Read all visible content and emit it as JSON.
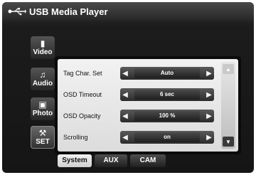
{
  "header": {
    "title": "USB Media Player"
  },
  "sidebar": {
    "items": [
      {
        "label": "Video",
        "icon": "film-icon"
      },
      {
        "label": "Audio",
        "icon": "music-note-icon"
      },
      {
        "label": "Photo",
        "icon": "camera-icon"
      },
      {
        "label": "SET",
        "icon": "wrench-icon"
      }
    ]
  },
  "settings": {
    "rows": [
      {
        "label": "Tag Char. Set",
        "value": "Auto"
      },
      {
        "label": "OSD Timeout",
        "value": "6 sec"
      },
      {
        "label": "OSD Opacity",
        "value": "100 %"
      },
      {
        "label": "Scrolling",
        "value": "on"
      }
    ]
  },
  "bottom_tabs": [
    {
      "label": "System",
      "active": true
    },
    {
      "label": "AUX",
      "active": false
    },
    {
      "label": "CAM",
      "active": false
    }
  ],
  "colors": {
    "frame": "#151515",
    "panel": "#e6e6e6",
    "control": "#2b2b2b"
  }
}
